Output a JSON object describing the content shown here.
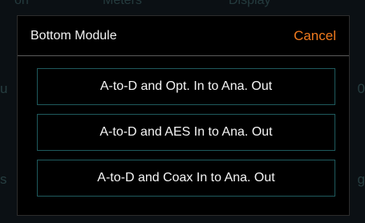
{
  "background": {
    "left_letter_top": "u",
    "left_letter_bottom": "s",
    "right_letter_top": "0",
    "right_letter_bottom": "g",
    "top_tabs": [
      "on",
      "Meters",
      "Display"
    ]
  },
  "dialog": {
    "title": "Bottom Module",
    "cancel_label": "Cancel",
    "cancel_color": "#f07a1e",
    "border_color": "#1f5a5d",
    "options": [
      {
        "label": "A-to-D and Opt. In to Ana. Out"
      },
      {
        "label": "A-to-D and AES In to Ana. Out"
      },
      {
        "label": "A-to-D and Coax In to Ana. Out"
      }
    ]
  }
}
